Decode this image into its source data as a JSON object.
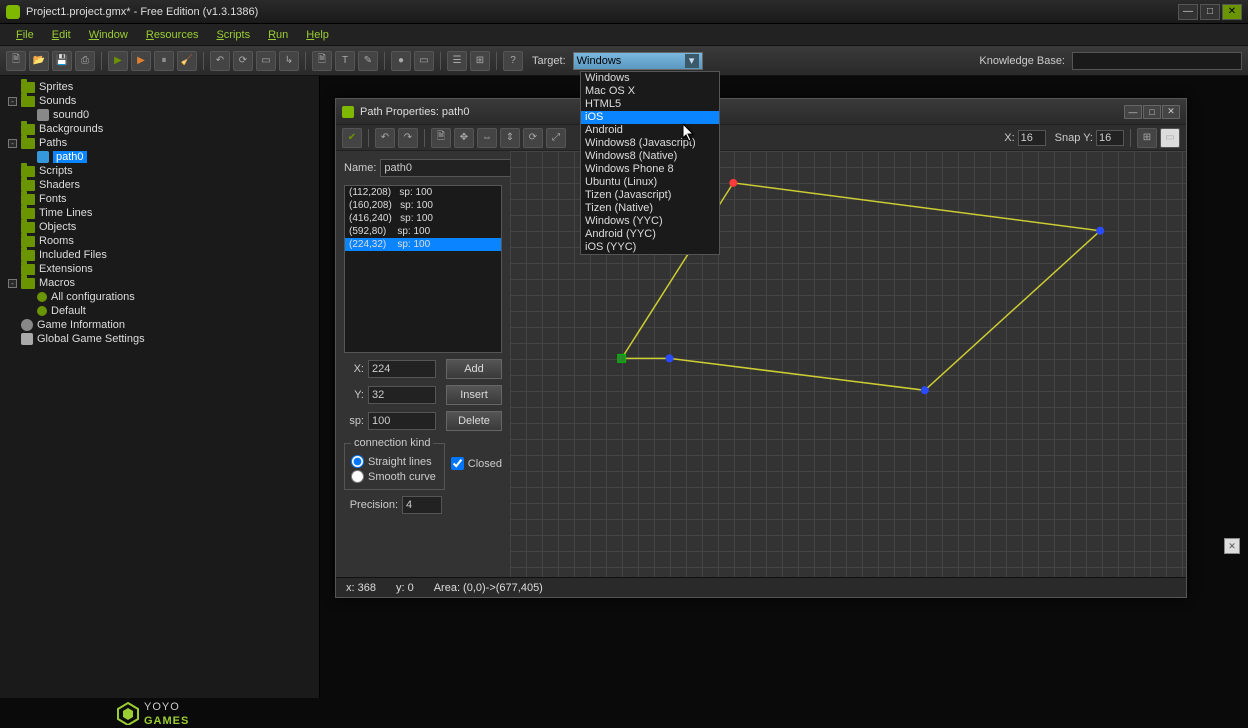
{
  "titlebar": {
    "text": "Project1.project.gmx*  -  Free Edition (v1.3.1386)"
  },
  "menu": [
    "File",
    "Edit",
    "Window",
    "Resources",
    "Scripts",
    "Run",
    "Help"
  ],
  "toolbar": {
    "target_label": "Target:",
    "target_value": "Windows",
    "kb_label": "Knowledge Base:",
    "kb_value": ""
  },
  "target_options": [
    "Windows",
    "Mac OS X",
    "HTML5",
    "iOS",
    "Android",
    "Windows8 (Javascript)",
    "Windows8 (Native)",
    "Windows Phone 8",
    "Ubuntu (Linux)",
    "Tizen (Javascript)",
    "Tizen (Native)",
    "Windows (YYC)",
    "Android (YYC)",
    "iOS (YYC)"
  ],
  "target_highlight": "iOS",
  "tree": [
    {
      "l": 0,
      "exp": "",
      "icon": "folder",
      "label": "Sprites"
    },
    {
      "l": 0,
      "exp": "-",
      "icon": "folder",
      "label": "Sounds"
    },
    {
      "l": 1,
      "exp": "",
      "icon": "sound",
      "label": "sound0"
    },
    {
      "l": 0,
      "exp": "",
      "icon": "folder",
      "label": "Backgrounds"
    },
    {
      "l": 0,
      "exp": "-",
      "icon": "folder",
      "label": "Paths"
    },
    {
      "l": 1,
      "exp": "",
      "icon": "path",
      "label": "path0",
      "selected": true
    },
    {
      "l": 0,
      "exp": "",
      "icon": "folder",
      "label": "Scripts"
    },
    {
      "l": 0,
      "exp": "",
      "icon": "folder",
      "label": "Shaders"
    },
    {
      "l": 0,
      "exp": "",
      "icon": "folder",
      "label": "Fonts"
    },
    {
      "l": 0,
      "exp": "",
      "icon": "folder",
      "label": "Time Lines"
    },
    {
      "l": 0,
      "exp": "",
      "icon": "folder",
      "label": "Objects"
    },
    {
      "l": 0,
      "exp": "",
      "icon": "folder",
      "label": "Rooms"
    },
    {
      "l": 0,
      "exp": "",
      "icon": "folder",
      "label": "Included Files"
    },
    {
      "l": 0,
      "exp": "",
      "icon": "folder",
      "label": "Extensions"
    },
    {
      "l": 0,
      "exp": "-",
      "icon": "folder",
      "label": "Macros"
    },
    {
      "l": 1,
      "exp": "",
      "icon": "cfg",
      "label": "All configurations"
    },
    {
      "l": 1,
      "exp": "",
      "icon": "cfg",
      "label": "Default"
    },
    {
      "l": 0,
      "exp": "",
      "icon": "info",
      "label": "Game Information"
    },
    {
      "l": 0,
      "exp": "",
      "icon": "gear",
      "label": "Global Game Settings"
    }
  ],
  "pathwin": {
    "title": "Path Properties: path0",
    "name_label": "Name:",
    "name_value": "path0",
    "points": [
      {
        "txt": "(112,208)   sp: 100",
        "sel": false
      },
      {
        "txt": "(160,208)   sp: 100",
        "sel": false
      },
      {
        "txt": "(416,240)   sp: 100",
        "sel": false
      },
      {
        "txt": "(592,80)    sp: 100",
        "sel": false
      },
      {
        "txt": "(224,32)    sp: 100",
        "sel": true
      }
    ],
    "x_label": "X:",
    "x_value": "224",
    "y_label": "Y:",
    "y_value": "32",
    "sp_label": "sp:",
    "sp_value": "100",
    "add": "Add",
    "insert": "Insert",
    "delete": "Delete",
    "fieldset": "connection kind",
    "r1": "Straight lines",
    "r2": "Smooth curve",
    "closed": "Closed",
    "precision_label": "Precision:",
    "precision_value": "4",
    "snapx_label": "X: ",
    "snapx": "16",
    "snapy_label": "Snap Y: ",
    "snapy": "16",
    "status": {
      "x": "x: 368",
      "y": "y: 0",
      "area": "Area: (0,0)->(677,405)"
    }
  },
  "footer": {
    "brand1": "YOYO",
    "brand2": "GAMES"
  }
}
